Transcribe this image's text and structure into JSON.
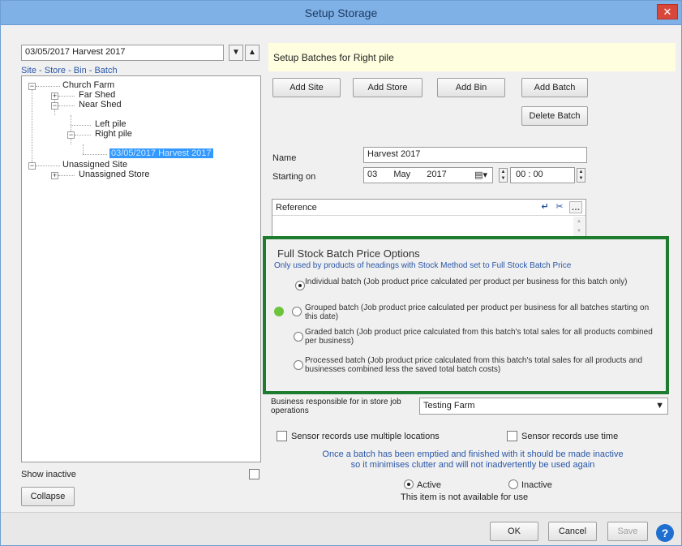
{
  "window": {
    "title": "Setup Storage",
    "close_label": "✕"
  },
  "left": {
    "batch_select_value": "03/05/2017 Harvest 2017",
    "nav_down": "▼",
    "nav_up": "▲",
    "hierarchy_caption": "Site - Store - Bin - Batch",
    "tree": {
      "church_farm": "Church Farm",
      "far_shed": "Far Shed",
      "near_shed": "Near Shed",
      "left_pile": "Left pile",
      "right_pile": "Right pile",
      "batch": "03/05/2017 Harvest 2017",
      "unassigned_site": "Unassigned Site",
      "unassigned_store": "Unassigned Store"
    },
    "show_inactive_label": "Show inactive",
    "collapse_label": "Collapse"
  },
  "right": {
    "header": "Setup Batches for Right pile",
    "buttons": {
      "add_site": "Add Site",
      "add_store": "Add Store",
      "add_bin": "Add Bin",
      "add_batch": "Add Batch",
      "delete_batch": "Delete Batch"
    },
    "name_label": "Name",
    "name_value": "Harvest 2017",
    "starting_on_label": "Starting on",
    "date": {
      "day": "03",
      "month": "May",
      "year": "2017"
    },
    "time": {
      "hour": "00",
      "minute": "00"
    },
    "reference_label": "Reference",
    "price_options": {
      "title": "Full Stock Batch Price Options",
      "subtitle": "Only used by products of headings with Stock Method set to Full Stock Batch Price",
      "options": [
        {
          "text": "Individual batch (Job product price calculated per product per business for this batch only)",
          "checked": true
        },
        {
          "text": "Grouped batch (Job product price calculated per product per business for all batches starting on this date)",
          "checked": false
        },
        {
          "text": "Graded batch (Job product price calculated from this batch's total sales for all products combined per business)",
          "checked": false
        },
        {
          "text": "Processed batch (Job product price calculated from this batch's total sales for all products and businesses combined less the saved total batch costs)",
          "checked": false
        }
      ]
    },
    "business_label": "Business responsible for in store job operations",
    "business_value": "Testing Farm",
    "sensor_multiple_label": "Sensor records use multiple locations",
    "sensor_time_label": "Sensor records use time",
    "inactive_note": "Once a batch has been emptied and finished with it should be made inactive so it minimises clutter and will not inadvertently be used again",
    "active_label": "Active",
    "inactive_label": "Inactive",
    "availability_text": "This item is not available for use"
  },
  "footer": {
    "ok": "OK",
    "cancel": "Cancel",
    "save": "Save",
    "help": "?"
  }
}
